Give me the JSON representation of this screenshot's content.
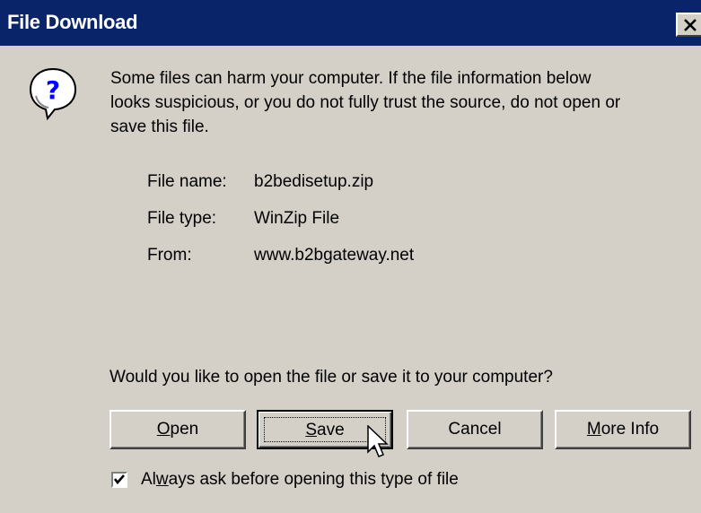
{
  "window": {
    "title": "File Download"
  },
  "message": {
    "line1": "Some files can harm your computer. If the file information below",
    "line2": "looks suspicious, or you do not fully trust the source, do not open or",
    "line3": "save this file."
  },
  "file_info": {
    "name_label": "File name:",
    "name_value": "b2bedisetup.zip",
    "type_label": "File type:",
    "type_value": "WinZip File",
    "from_label": "From:",
    "from_value": "www.b2bgateway.net"
  },
  "question": "Would you like to open the file or save it to your computer?",
  "buttons": {
    "open": {
      "mnemonic": "O",
      "rest": "pen"
    },
    "save": {
      "mnemonic": "S",
      "rest": "ave"
    },
    "cancel": "Cancel",
    "more_info": {
      "mnemonic": "M",
      "rest": "ore Info"
    }
  },
  "checkbox": {
    "checked": true,
    "label_pre": "Al",
    "label_mnemonic": "w",
    "label_post": "ays ask before opening this type of file"
  },
  "colors": {
    "titlebar": "#0a246a",
    "face": "#d4d0c8",
    "icon_blue": "#0000ff"
  },
  "icons": {
    "message": "question-balloon-icon",
    "close": "close-x-icon",
    "cursor": "arrow-cursor-icon"
  }
}
